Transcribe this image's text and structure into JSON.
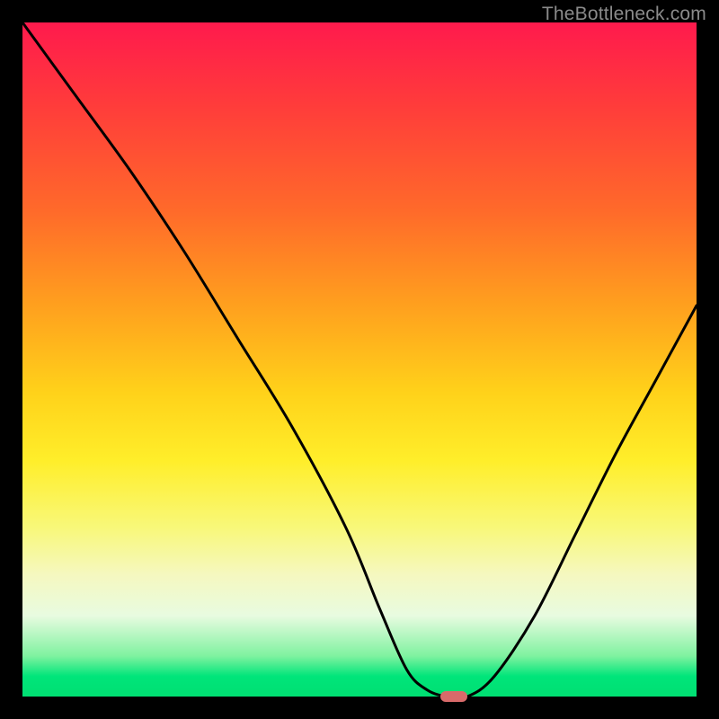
{
  "watermark": "TheBottleneck.com",
  "chart_data": {
    "type": "line",
    "title": "",
    "xlabel": "",
    "ylabel": "",
    "xlim": [
      0,
      100
    ],
    "ylim": [
      0,
      100
    ],
    "grid": false,
    "legend": false,
    "background": "gradient-red-to-green",
    "series": [
      {
        "name": "bottleneck-curve",
        "x": [
          0,
          8,
          16,
          24,
          32,
          40,
          48,
          53,
          57,
          60,
          63,
          66,
          70,
          76,
          82,
          88,
          94,
          100
        ],
        "y": [
          100,
          89,
          78,
          66,
          53,
          40,
          25,
          13,
          4,
          1,
          0,
          0,
          3,
          12,
          24,
          36,
          47,
          58
        ]
      }
    ],
    "marker": {
      "x": 64,
      "y": 0,
      "width_pct": 4,
      "height_pct": 1.5
    }
  },
  "colors": {
    "curve": "#000000",
    "marker": "#d86a6a",
    "frame": "#000000"
  }
}
